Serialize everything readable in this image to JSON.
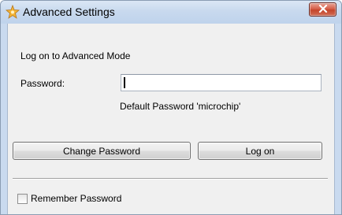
{
  "window": {
    "title": "Advanced Settings",
    "icon": "wizard-star-icon",
    "close_icon": "close-x-icon"
  },
  "form": {
    "heading": "Log on to Advanced Mode",
    "password_label": "Password:",
    "password_value": "",
    "hint": "Default Password 'microchip'"
  },
  "buttons": {
    "change_password": "Change Password",
    "log_on": "Log on"
  },
  "remember": {
    "label": "Remember Password",
    "checked": false
  },
  "colors": {
    "close_button": "#c4452b",
    "titlebar": "#c8d9ee",
    "client_bg": "#f0f0f0"
  }
}
